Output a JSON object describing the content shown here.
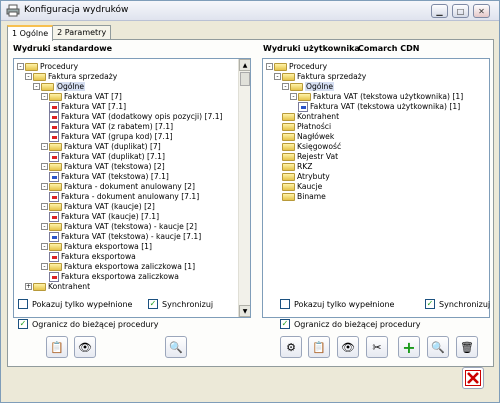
{
  "window": {
    "title": "Konfiguracja wydruków"
  },
  "tabs": [
    {
      "label": "1 Ogólne"
    },
    {
      "label": "2 Parametry"
    }
  ],
  "left": {
    "header": "Wydruki standardowe",
    "tree": [
      "Procedury",
      "Faktura sprzedaży",
      "Ogólne",
      "Faktura VAT [7]",
      "Faktura VAT [7.1]",
      "Faktura VAT (dodatkowy opis pozycji) [7.1]",
      "Faktura VAT (z rabatem) [7.1]",
      "Faktura VAT (grupa kod) [7.1]",
      "Faktura VAT (duplikat) [7]",
      "Faktura VAT (duplikat) [7.1]",
      "Faktura VAT (tekstowa) [2]",
      "Faktura VAT (tekstowa) [7.1]",
      "Faktura - dokument anulowany [2]",
      "Faktura - dokument anulowany [7.1]",
      "Faktura VAT (kaucje) [2]",
      "Faktura VAT (kaucje) [7.1]",
      "Faktura VAT (tekstowa) - kaucje [2]",
      "Faktura VAT (tekstowa) - kaucje [7.1]",
      "Faktura eksportowa [1]",
      "Faktura eksportowa",
      "Faktura eksportowa zaliczkowa [1]",
      "Faktura eksportowa zaliczkowa",
      "Kontrahent"
    ],
    "cb_only_filled": "Pokazuj tylko wypełnione",
    "cb_sync": "Synchronizuj",
    "cb_limit": "Ogranicz do bieżącej procedury"
  },
  "right": {
    "header": "Wydruki użytkownika",
    "header2": "Comarch CDN",
    "tree": [
      "Procedury",
      "Faktura sprzedaży",
      "Ogólne",
      "Faktura VAT (tekstowa użytkownika) [1]",
      "Faktura VAT (tekstowa użytkownika) [1]",
      "Kontrahent",
      "Płatności",
      "Nagłówek",
      "Księgowość",
      "Rejestr Vat",
      "RKZ",
      "Atrybuty",
      "Kaucje",
      "Biname"
    ],
    "cb_only_filled": "Pokazuj tylko wypełnione",
    "cb_sync": "Synchronizuj",
    "cb_limit": "Ogranicz do bieżącej procedury"
  },
  "checks": {
    "left_only_filled": false,
    "left_sync": true,
    "left_limit": true,
    "right_only_filled": false,
    "right_sync": true,
    "right_limit": true
  }
}
